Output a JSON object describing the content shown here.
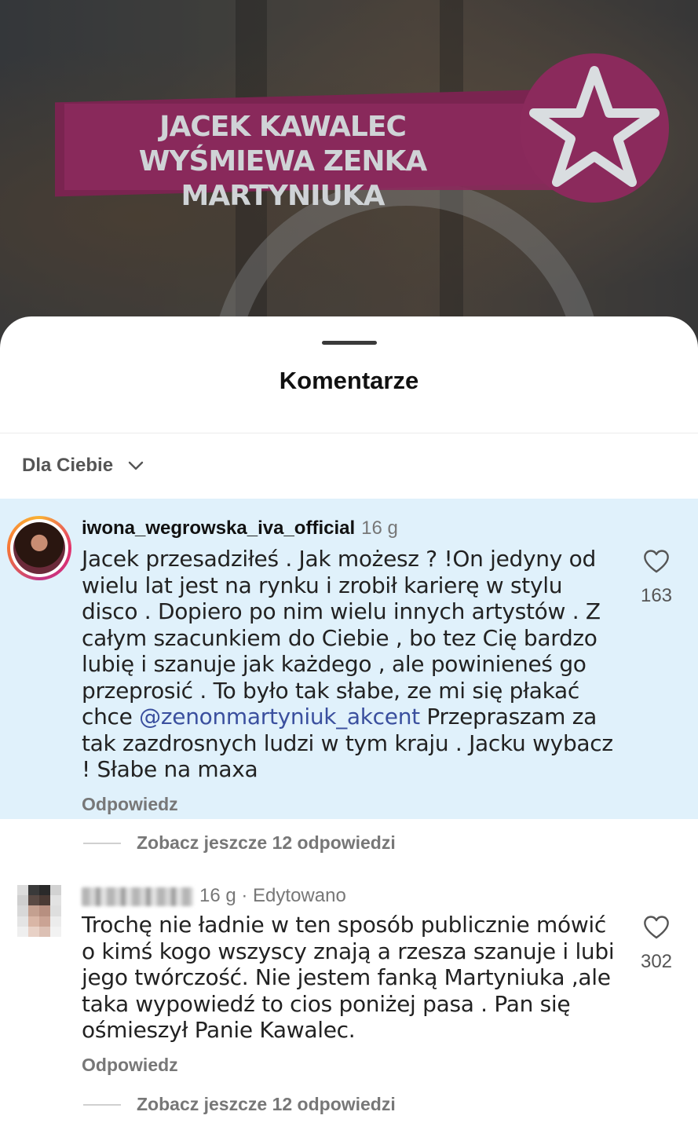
{
  "video": {
    "headline": "JACEK KAWALEC WYŚMIEWA ZENKA MARTYNIUKA"
  },
  "sheet": {
    "title": "Komentarze",
    "sort_label": "Dla Ciebie"
  },
  "comments": [
    {
      "username": "iwona_wegrowska_iva_official",
      "meta": "16 g",
      "text_before": "Jacek przesadziłeś . Jak możesz ? !On jedyny od wielu lat jest na rynku i zrobił karierę w stylu disco . Dopiero po nim wielu innych artystów . Z całym szacunkiem do Ciebie , bo tez Cię bardzo lubię i szanuje jak każdego , ale powinieneś go przeprosić . To było tak słabe, ze mi się płakać chce ",
      "mention": "@zenonmartyniuk_akcent",
      "text_after": " Przepraszam za tak zazdrosnych ludzi w tym kraju . Jacku wybacz ! Słabe na maxa",
      "likes": "163",
      "reply_label": "Odpowiedz",
      "more_replies": "Zobacz jeszcze 12 odpowiedzi"
    },
    {
      "username": "",
      "meta": "16 g · Edytowano",
      "text": "Trochę nie ładnie w ten sposób publicznie mówić o kimś kogo wszyscy znają a rzesza szanuje i lubi jego twórczość.  Nie jestem fanką Martyniuka ,ale taka wypowiedź to cios poniżej pasa . Pan się ośmieszył Panie Kawalec.",
      "likes": "302",
      "reply_label": "Odpowiedz",
      "more_replies": "Zobacz jeszcze 12 odpowiedzi"
    }
  ],
  "colors": {
    "highlight_bg": "#e0f1fb",
    "mention": "#3a4f9e",
    "banner": "#8b2a5c"
  },
  "icons": {
    "like": "heart-outline-icon",
    "sort": "chevron-down-icon"
  }
}
